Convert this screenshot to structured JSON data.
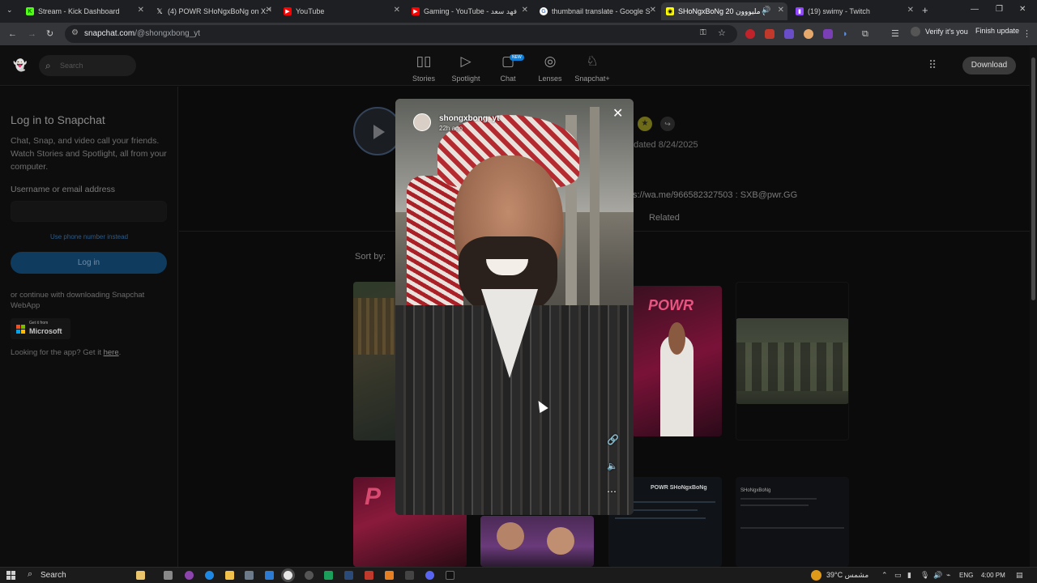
{
  "browser": {
    "tabs": [
      {
        "title": "Stream - Kick Dashboard",
        "icon": "kick-icon",
        "color": "#53fc18"
      },
      {
        "title": "(4) POWR SHoNgxBoNg on X: '",
        "icon": "x-icon",
        "color": "#ffffff"
      },
      {
        "title": "YouTube",
        "icon": "youtube-icon",
        "color": "#ff0000"
      },
      {
        "title": "Gaming - YouTube - فهد سعد",
        "icon": "youtube-icon",
        "color": "#ff0000"
      },
      {
        "title": "thumbnail translate - Google S",
        "icon": "google-icon",
        "color": "#4285f4"
      },
      {
        "title": "SHoNgxBoNg 20 مليووون (",
        "icon": "snapchat-icon",
        "color": "#fffc00"
      },
      {
        "title": "(19) swimy - Twitch",
        "icon": "twitch-icon",
        "color": "#9146ff"
      }
    ],
    "new_tab": "+",
    "url_host": "snapchat.com",
    "url_path": "/@shongxbong_yt",
    "verify_label": "Verify it's you",
    "finish_update": "Finish update"
  },
  "snap_header": {
    "search_placeholder": "Search",
    "nav": [
      {
        "label": "Stories",
        "icon": "stories-icon"
      },
      {
        "label": "Spotlight",
        "icon": "spotlight-icon"
      },
      {
        "label": "Chat",
        "icon": "chat-icon",
        "badge": "NEW"
      },
      {
        "label": "Lenses",
        "icon": "lenses-icon"
      },
      {
        "label": "Snapchat+",
        "icon": "snapchat-plus-icon"
      }
    ],
    "download": "Download"
  },
  "sidebar": {
    "title": "Log in to Snapchat",
    "description": "Chat, Snap, and video call your friends. Watch Stories and Spotlight, all from your computer.",
    "username_label": "Username or email address",
    "phone_link": "Use phone number instead",
    "login_button": "Log in",
    "continue_text": "or continue with downloading Snapchat WebApp",
    "ms_get": "Get it from",
    "ms_name": "Microsoft",
    "app_text_prefix": "Looking for the app? Get it ",
    "app_text_link": "here",
    "app_text_suffix": "."
  },
  "profile": {
    "updated": "pdated 8/24/2025",
    "bio_link": "s://wa.me/966582327503 : SXB@pwr.GG",
    "related_tab": "Related",
    "sort_by": "Sort by:"
  },
  "thumbnails": {
    "powr_text": "POWR",
    "powr_profile_text": "POWR SHoNgxBoNg",
    "sxb_profile_text": "SHoNgxBoNg"
  },
  "viewer": {
    "username": "shongxbong_yt",
    "time_ago": "22h ago"
  },
  "taskbar": {
    "search": "Search",
    "weather": "39°C مشمس",
    "lang": "ENG",
    "clock": "4:00 PM"
  }
}
